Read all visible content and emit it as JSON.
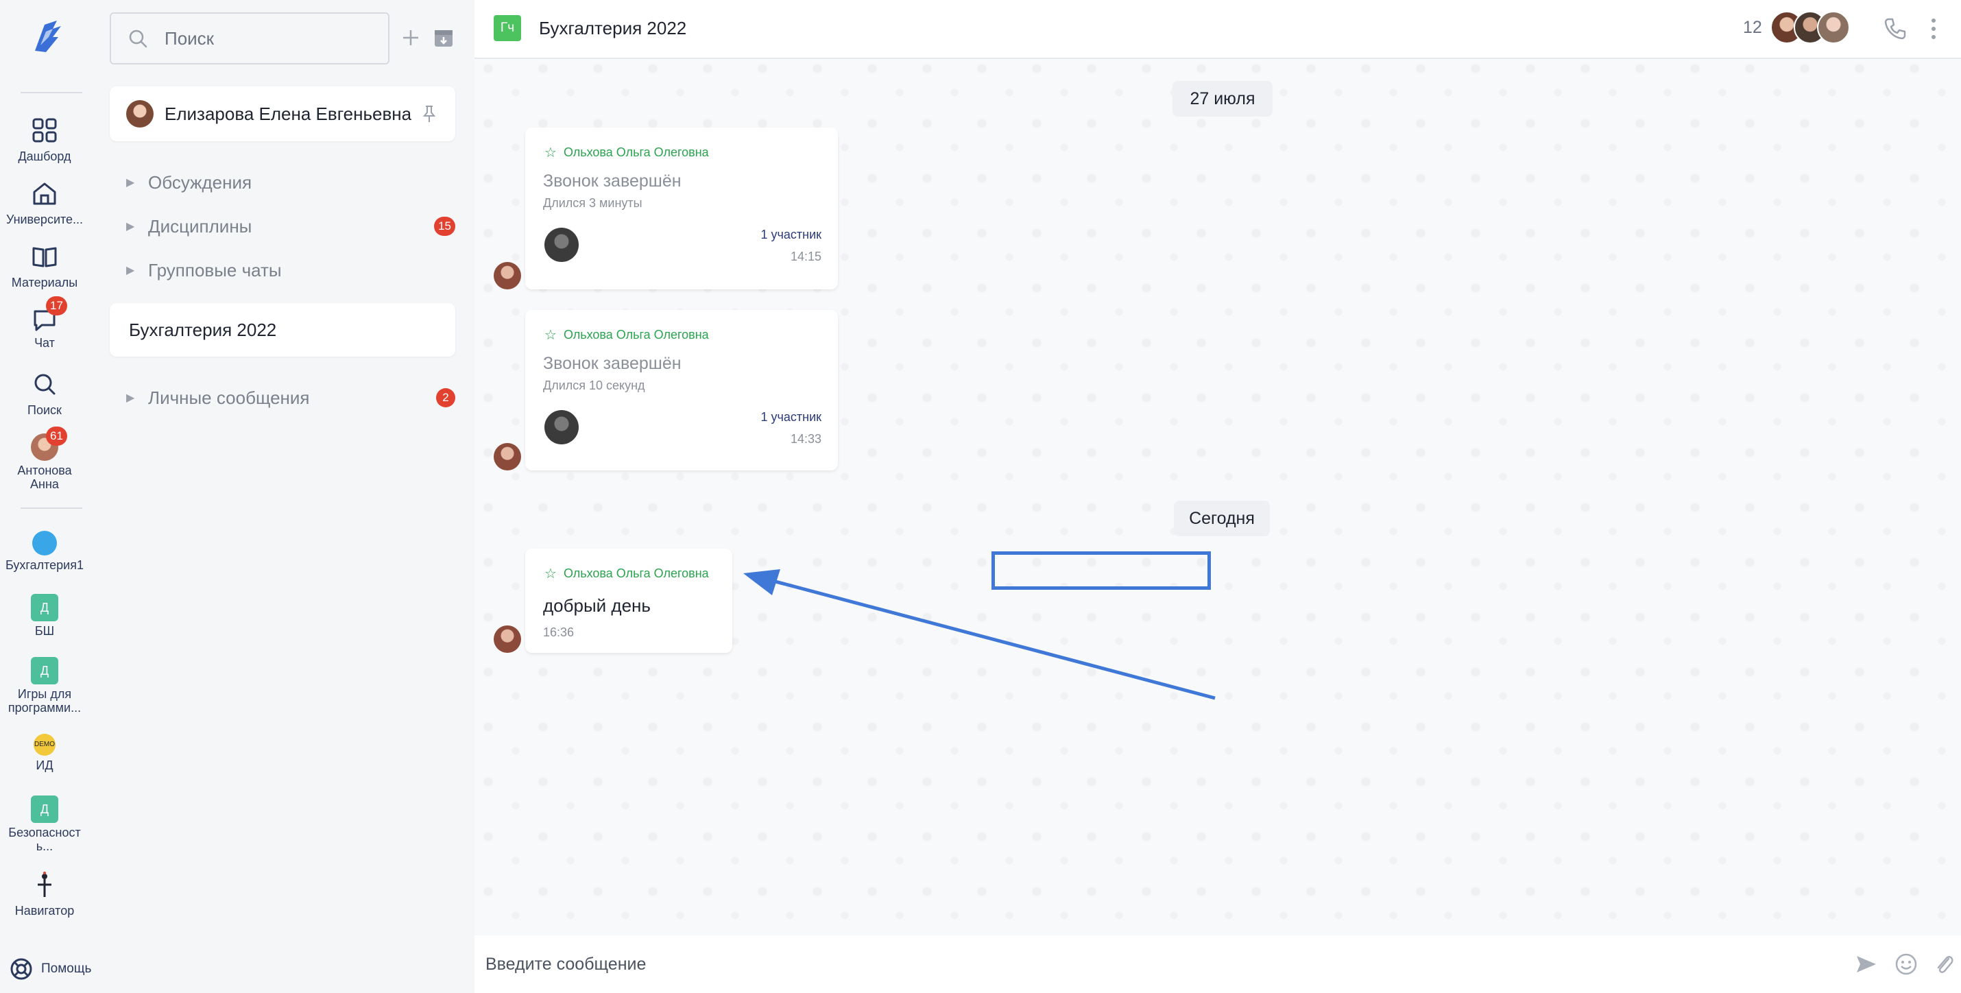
{
  "rail": {
    "items": [
      {
        "label": "Дашборд"
      },
      {
        "label": "Университе..."
      },
      {
        "label": "Материалы"
      },
      {
        "label": "Чат",
        "badge": "17"
      },
      {
        "label": "Поиск"
      },
      {
        "label": "Антонова Анна",
        "badge": "61"
      }
    ],
    "spaces": [
      {
        "label": "Бухгалтерия1"
      },
      {
        "label": "БШ",
        "tile": "Д"
      },
      {
        "label": "Игры для программи...",
        "tile": "Д"
      },
      {
        "label": "ИД",
        "tile": "DEMO"
      },
      {
        "label": "Безопасност ь...",
        "tile": "Д"
      },
      {
        "label": "Навигатор"
      }
    ],
    "help_label": "Помощь"
  },
  "sidebar": {
    "search_placeholder": "Поиск",
    "pinned": {
      "name": "Елизарова Елена Евгеньевна"
    },
    "groups": [
      {
        "label": "Обсуждения"
      },
      {
        "label": "Дисциплины",
        "badge": "15"
      },
      {
        "label": "Групповые чаты"
      }
    ],
    "active_chat": "Бухгалтерия 2022",
    "personal": {
      "label": "Личные сообщения",
      "badge": "2"
    }
  },
  "chat": {
    "tag": "Гч",
    "title": "Бухгалтерия 2022",
    "member_count": "12",
    "date_separators": [
      "27 июля",
      "Сегодня"
    ],
    "messages": [
      {
        "sender": "Ольхова Ольга Олеговна",
        "title": "Звонок завершён",
        "duration": "Длился 3 минуты",
        "participants": "1 участник",
        "time": "14:15"
      },
      {
        "sender": "Ольхова Ольга Олеговна",
        "title": "Звонок завершён",
        "duration": "Длился 10 секунд",
        "participants": "1 участник",
        "time": "14:33"
      },
      {
        "sender": "Ольхова Ольга Олеговна",
        "text": "добрый день",
        "time": "16:36"
      }
    ],
    "composer_placeholder": "Введите сообщение"
  },
  "colors": {
    "accent_green": "#2aa44f",
    "badge_red": "#e2412f",
    "annotation_blue": "#3f78d6",
    "tile_green": "#4dbf9a"
  }
}
